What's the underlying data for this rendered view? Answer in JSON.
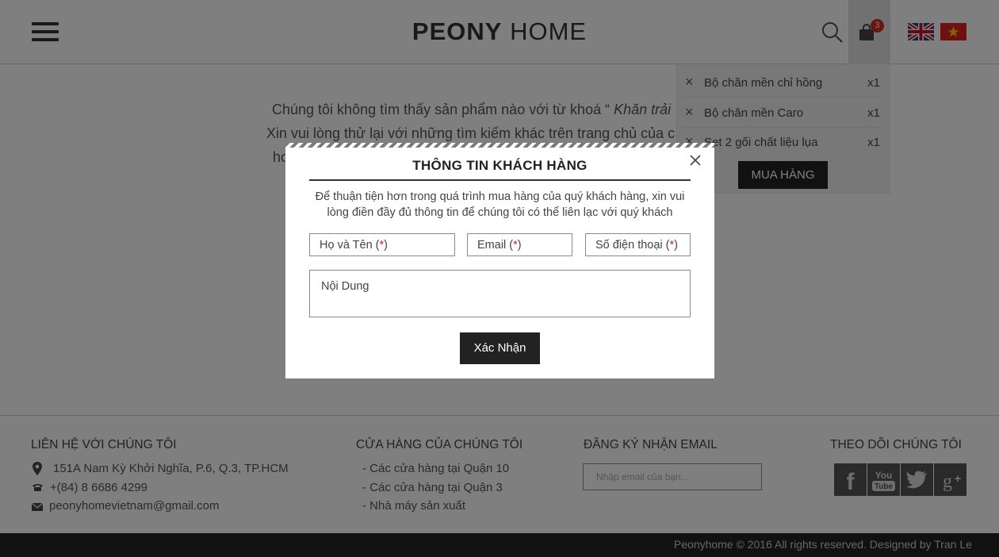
{
  "header": {
    "logo_bold": "PEONY",
    "logo_thin": "HOME",
    "cart_count": "3"
  },
  "notfound": {
    "line1_prefix": "Chúng tôi không tìm thấy sản phẩm nào với từ khoá “",
    "line1_keyword": "Khăn trải",
    "line2": "Xin vui lòng thử lại với những tìm kiếm khác trên trang chủ của c",
    "line3": "ho"
  },
  "cart": {
    "items": [
      {
        "name": "Bộ chăn mền chỉ hồng",
        "qty": "x1"
      },
      {
        "name": "Bộ chăn mền Caro",
        "qty": "x1"
      },
      {
        "name": "Set 2 gối chất liệu lụa",
        "qty": "x1"
      }
    ],
    "buy_label": "MUA HÀNG"
  },
  "modal": {
    "title": "THÔNG TIN KHÁCH HÀNG",
    "description": "Để thuận tiện hơn trong quá trình mua hàng của quý khách hàng, xin vui lòng điền đầy đủ thông tin để chúng tôi có thể liên lạc với quý khách",
    "name_placeholder": "Họ và Tên (",
    "email_placeholder": "Email (",
    "phone_placeholder": "Số điện thoại (",
    "required_mark": "*",
    "close_paren": ")",
    "content_placeholder": "Nội Dung",
    "submit_label": "Xác Nhận"
  },
  "footer": {
    "contact_heading": "LIÊN HỆ VỚI CHÚNG TÔI",
    "address": "151A Nam Kỳ Khởi Nghĩa, P.6, Q.3, TP.HCM",
    "phone": "+(84) 8 6686 4299",
    "email": "peonyhomevietnam@gmail.com",
    "stores_heading": "CỬA HÀNG CỦA CHÚNG TÔI",
    "stores": [
      "- Các cửa hàng tại Quận 10",
      "- Các cửa hàng tại Quận 3",
      "- Nhà máy sản xuất"
    ],
    "newsletter_heading": "ĐĂNG KÝ NHẬN EMAIL",
    "newsletter_placeholder": "Nhập email của bạn...",
    "follow_heading": "THEO DÕI CHÚNG TÔI",
    "copyright": "Peonyhome © 2016 All rights reserved. Designed by Tran Le"
  },
  "colors": {
    "accent_dark": "#222222",
    "badge_red": "#d0281f",
    "cart_bg": "#f1f1f1"
  }
}
